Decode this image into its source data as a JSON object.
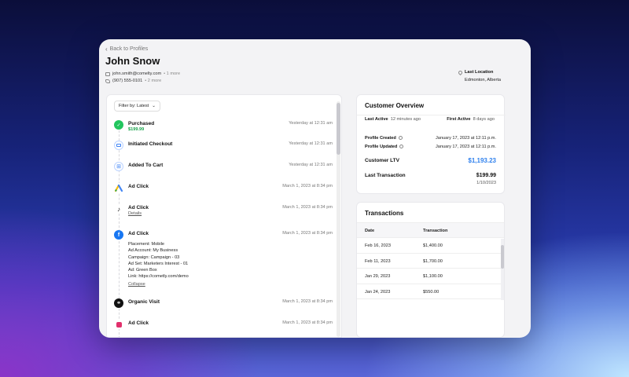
{
  "header": {
    "back_label": "Back to Profiles",
    "name": "John Snow",
    "email": "john.smith@comelty.com",
    "email_more": "• 1 more",
    "phone": "(907) 555-0101",
    "phone_more": "• 2 more",
    "location_label": "Last Location",
    "location_value": "Edmonton, Alberta"
  },
  "filter": {
    "label": "Filter by: Latest"
  },
  "events": [
    {
      "title": "Purchased",
      "sub": "$199.99",
      "time": "Yesterday at 12:31 am",
      "icon": "check-icon",
      "color": "#22c55e"
    },
    {
      "title": "Initiated Checkout",
      "time": "Yesterday at 12:31 am",
      "icon": "card-icon",
      "color": "#3b82f6"
    },
    {
      "title": "Added To Cart",
      "time": "Yesterday at 12:31 am",
      "icon": "cart-icon",
      "color": "#3b82f6"
    },
    {
      "title": "Ad Click",
      "time": "March 1, 2023 at 8:34 pm",
      "icon": "google-ads-icon"
    },
    {
      "title": "Ad Click",
      "sub": "Details",
      "time": "March 1, 2023 at 8:34 pm",
      "icon": "tiktok-icon"
    },
    {
      "title": "Ad Click",
      "time": "March 1, 2023 at 8:34 pm",
      "icon": "facebook-icon",
      "color": "#1877f2",
      "details": [
        "Placement: Mobile",
        "Ad Account: My Business",
        "Campaign: Campaign - 03",
        "Ad Set: Marketers Interest - 01",
        "Ad: Green Box",
        "Link: https://cometly.com/demo"
      ],
      "collapse": "Collapse"
    },
    {
      "title": "Organic Visit",
      "time": "March 1, 2023 at 8:34 pm",
      "icon": "link-icon",
      "color": "#111111"
    },
    {
      "title": "Ad Click",
      "time": "March 1, 2023 at 8:34 pm",
      "icon": "instagram-icon",
      "color": "#e1306c"
    }
  ],
  "overview": {
    "title": "Customer Overview",
    "last_active_label": "Last Active",
    "last_active_value": "12 minutes ago",
    "first_active_label": "First Active",
    "first_active_value": "8 days ago",
    "profile_created_label": "Profile Created",
    "profile_created_value": "January 17, 2023 at 12:11 p.m.",
    "profile_updated_label": "Profile Updated",
    "profile_updated_value": "January 17, 2023 at 12:11 p.m.",
    "ltv_label": "Customer LTV",
    "ltv_value": "$1,193.23",
    "last_tx_label": "Last Transaction",
    "last_tx_value": "$199.99",
    "last_tx_date": "1/10/2023"
  },
  "transactions": {
    "title": "Transactions",
    "columns": [
      "Date",
      "Transaction"
    ],
    "rows": [
      [
        "Feb 16, 2023",
        "$1,400.00"
      ],
      [
        "Feb 11, 2023",
        "$1,700.00"
      ],
      [
        "Jan 29, 2023",
        "$1,100.00"
      ],
      [
        "Jan 24, 2023",
        "$550.00"
      ]
    ]
  }
}
